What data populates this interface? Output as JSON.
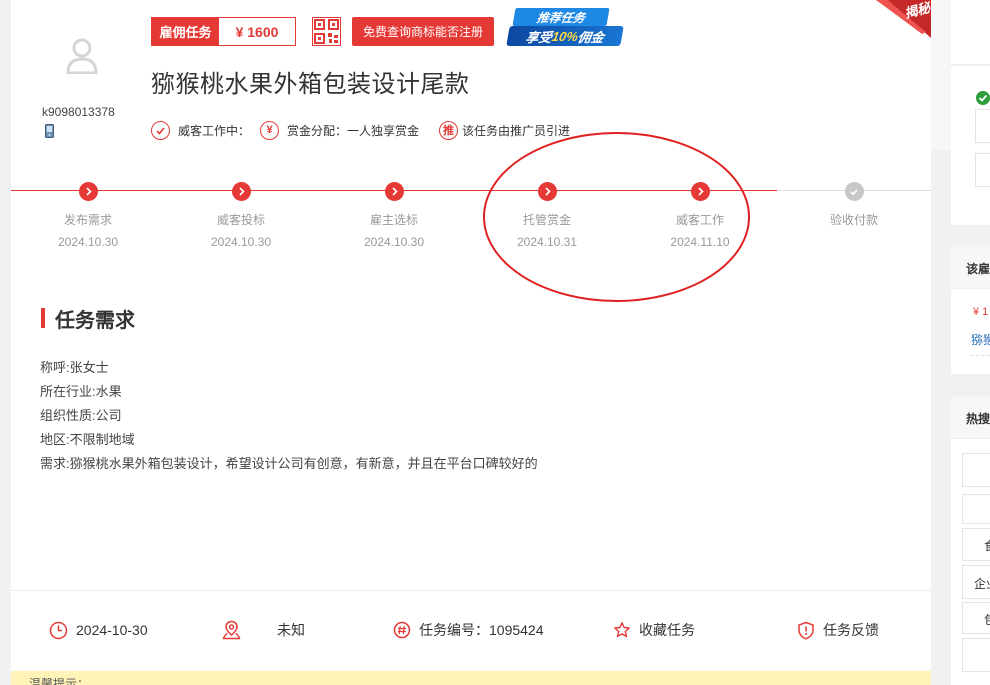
{
  "user": {
    "name": "k9098013378"
  },
  "badge": {
    "label": "雇佣任务",
    "price": "¥ 1600"
  },
  "trademark_button": "免费查询商标能否注册",
  "promo": {
    "line1": "推荐任务",
    "line2_prefix": "享受",
    "line2_highlight": "10%",
    "line2_suffix": "佣金"
  },
  "ribbon": "揭秘",
  "task": {
    "title": "猕猴桃水果外箱包装设计尾款"
  },
  "meta": {
    "status": "威客工作中：",
    "reward_mode": "赏金分配：一人独享赏金",
    "referral": "该任务由推广员引进"
  },
  "steps": [
    {
      "label": "发布需求",
      "date": "2024.10.30"
    },
    {
      "label": "威客投标",
      "date": "2024.10.30"
    },
    {
      "label": "雇主选标",
      "date": "2024.10.30"
    },
    {
      "label": "托管赏金",
      "date": "2024.10.31"
    },
    {
      "label": "威客工作",
      "date": "2024.11.10"
    },
    {
      "label": "验收付款",
      "date": ""
    }
  ],
  "requirements": {
    "section_title": "任务需求",
    "lines": [
      "称呼:张女士",
      "所在行业:水果",
      "组织性质:公司",
      "地区:不限制地域",
      "需求:猕猴桃水果外箱包装设计，希望设计公司有创意，有新意，并且在平台口碑较好的"
    ]
  },
  "footer": {
    "date": "2024-10-30",
    "location": "未知",
    "task_number": "任务编号：1095424",
    "favorite": "收藏任务",
    "feedback": "任务反馈"
  },
  "tip": "温馨提示：",
  "sidebar": {
    "block2_heading": "该雇",
    "block2_price": "¥ 1",
    "block2_link": "猕猴",
    "block3_heading": "热搜",
    "block3_items": [
      "食",
      "企业",
      "包"
    ]
  },
  "colors": {
    "accent": "#e53935",
    "annotation": "#e02020",
    "tip_bg": "#fff3b8"
  }
}
